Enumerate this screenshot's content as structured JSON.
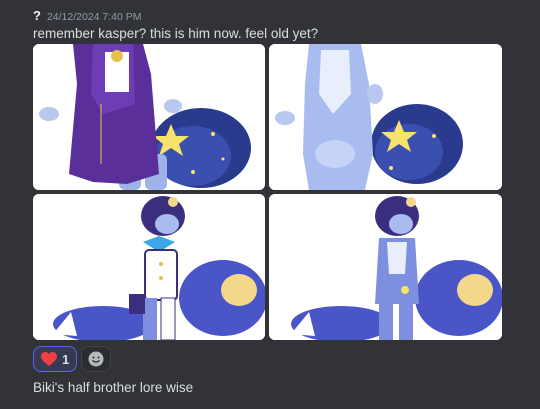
{
  "message": {
    "author": "?",
    "timestamp": "24/12/2024 7:40 PM",
    "text": "remember kasper? this is him now. feel old yet?",
    "attachments": [
      {
        "alt": "artwork-1"
      },
      {
        "alt": "artwork-2"
      },
      {
        "alt": "artwork-3"
      },
      {
        "alt": "artwork-4"
      }
    ],
    "reactions": [
      {
        "emoji": "heart-icon",
        "count": "1",
        "color": "#f23f43"
      }
    ]
  },
  "followup": {
    "text": "Biki's half brother lore wise"
  },
  "colors": {
    "background": "#313338",
    "text": "#dbdee1",
    "muted": "#949ba4",
    "accent": "#5865f2"
  }
}
